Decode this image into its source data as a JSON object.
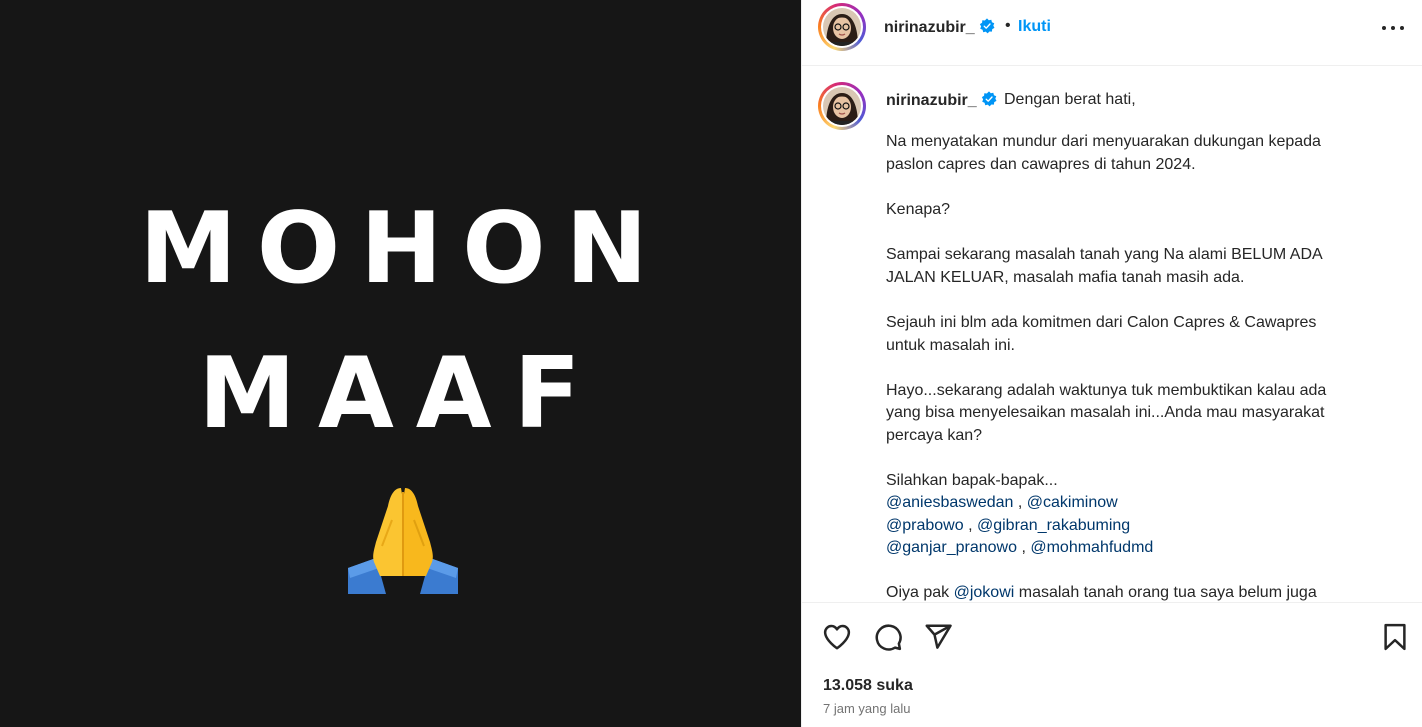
{
  "media": {
    "line1": "MOHON",
    "line2": "MAAF",
    "emoji": "folded-hands-icon"
  },
  "header": {
    "username": "nirinazubir_",
    "separator": "•",
    "follow_label": "Ikuti",
    "more_icon": "more-options-icon"
  },
  "caption": {
    "username": "nirinazubir_",
    "first_line": "Dengan berat hati,",
    "lines": [
      "Na menyatakan mundur dari menyuarakan dukungan kepada",
      "paslon capres dan cawapres di tahun 2024.",
      "Kenapa?",
      "Sampai sekarang masalah tanah yang Na alami BELUM ADA",
      "JALAN KELUAR, masalah mafia tanah masih ada.",
      "Sejauh ini blm ada komitmen dari Calon Capres & Cawapres",
      "untuk masalah ini.",
      "Hayo...sekarang adalah waktunya tuk membuktikan kalau ada",
      "yang bisa menyelesaikan masalah ini...Anda mau masyarakat",
      "percaya kan?",
      "Silahkan bapak-bapak..."
    ],
    "mentions": {
      "m1": "@aniesbaswedan",
      "m2": "@cakiminow",
      "m3": "@prabowo",
      "m4": "@gibran_rakabuming",
      "m5": "@ganjar_pranowo",
      "m6": "@mohmahfudmd",
      "m7": "@jokowi"
    },
    "sep": " , ",
    "last_before": "Oiya pak ",
    "last_after": " masalah tanah orang tua saya belum juga"
  },
  "footer": {
    "likes": "13.058 suka",
    "time": "7 jam yang lalu"
  },
  "colors": {
    "media_bg": "#161616",
    "link": "#0095f6",
    "mention": "#00376b",
    "verified": "#0095f6"
  }
}
